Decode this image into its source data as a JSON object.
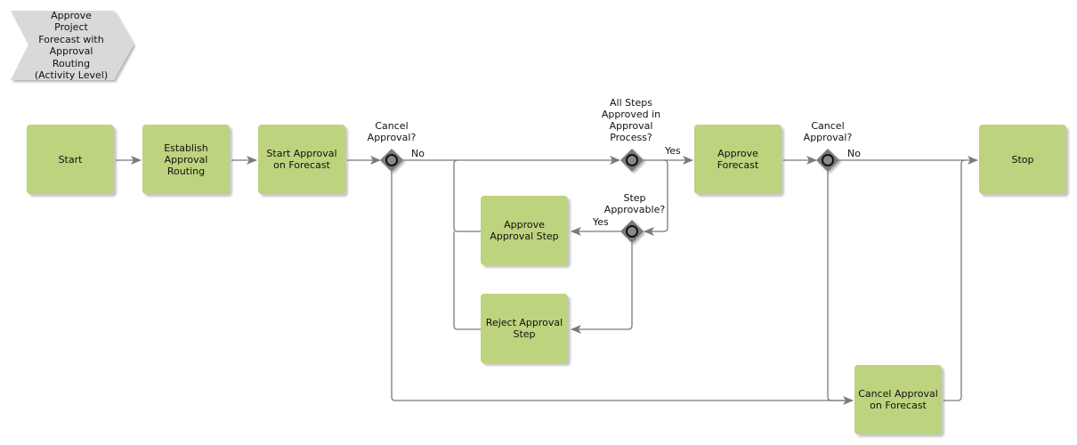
{
  "diagram_title": {
    "lines": [
      "Approve",
      "Project",
      "Forecast with",
      "Approval",
      "Routing",
      "(Activity Level)"
    ]
  },
  "nodes": {
    "start": {
      "label": "Start"
    },
    "establish": {
      "label": "Establish Approval Routing"
    },
    "start_approval": {
      "label": "Start Approval on Forecast"
    },
    "approve_step": {
      "label": "Approve Approval Step"
    },
    "reject_step": {
      "label": "Reject Approval Step"
    },
    "approve_forecast": {
      "label": "Approve Forecast"
    },
    "cancel_forecast": {
      "label": "Cancel Approval on Forecast"
    },
    "stop": {
      "label": "Stop"
    }
  },
  "gateways": {
    "cancel1": {
      "question": [
        "Cancel",
        "Approval?"
      ],
      "branch": "No"
    },
    "all_steps": {
      "question": [
        "All Steps",
        "Approved in",
        "Approval",
        "Process?"
      ],
      "branch": "Yes"
    },
    "step_approvable": {
      "question": [
        "Step",
        "Approvable?"
      ],
      "branch": "Yes"
    },
    "cancel2": {
      "question": [
        "Cancel",
        "Approval?"
      ],
      "branch": "No"
    }
  },
  "colors": {
    "task_fill": "#bdd37d",
    "gateway_fill": "#7a7a7a",
    "connector": "#7a7a7a",
    "title_fill": "#d9d9d9"
  }
}
